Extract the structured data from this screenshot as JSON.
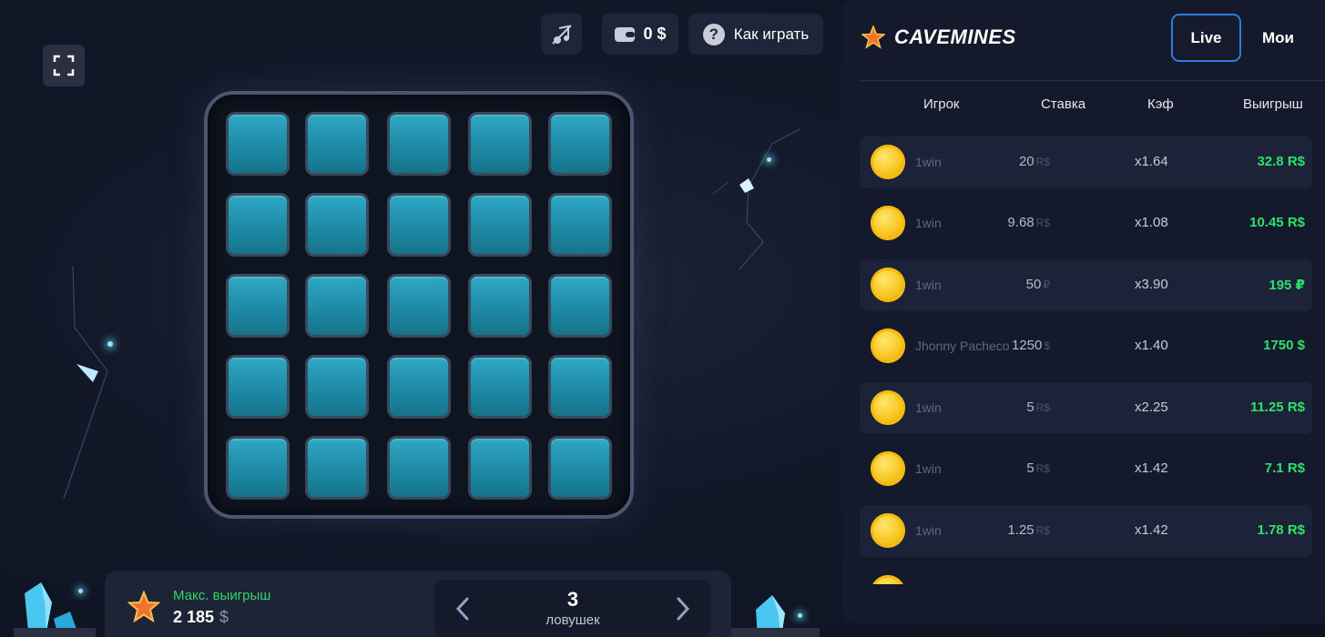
{
  "topbar": {
    "balance_value": "0",
    "balance_currency": "$",
    "help_label": "Как играть",
    "help_glyph": "?",
    "sound_icon": "sound-off-icon",
    "wallet_icon": "wallet-icon",
    "fullscreen_icon": "fullscreen-icon"
  },
  "board": {
    "rows": 5,
    "cols": 5
  },
  "bottom": {
    "maxwin_label": "Макс. выигрыш",
    "maxwin_value": "2 185",
    "maxwin_currency": "$",
    "traps_count": "3",
    "traps_label": "ловушек"
  },
  "sidebar": {
    "logo": "CAVEMINES",
    "tabs": [
      {
        "label": "Live"
      },
      {
        "label": "Мои"
      }
    ],
    "columns": {
      "player": "Игрок",
      "bet": "Ставка",
      "coef": "Кэф",
      "win": "Выигрыш"
    },
    "rows": [
      {
        "player": "1win",
        "bet": "20",
        "bet_currency": "R$",
        "coef": "x1.64",
        "win": "32.8 R$"
      },
      {
        "player": "1win",
        "bet": "9.68",
        "bet_currency": "R$",
        "coef": "x1.08",
        "win": "10.45 R$"
      },
      {
        "player": "1win",
        "bet": "50",
        "bet_currency": "₽",
        "coef": "x3.90",
        "win": "195 ₽"
      },
      {
        "player": "Jhonny Pacheco",
        "bet": "1250",
        "bet_currency": "$",
        "coef": "x1.40",
        "win": "1750 $"
      },
      {
        "player": "1win",
        "bet": "5",
        "bet_currency": "R$",
        "coef": "x2.25",
        "win": "11.25 R$"
      },
      {
        "player": "1win",
        "bet": "5",
        "bet_currency": "R$",
        "coef": "x1.42",
        "win": "7.1 R$"
      },
      {
        "player": "1win",
        "bet": "1.25",
        "bet_currency": "R$",
        "coef": "x1.42",
        "win": "1.78 R$"
      }
    ]
  },
  "colors": {
    "accent_blue": "#2d7bdc",
    "win_green": "#2fe06a",
    "tile": "#1e8aa6",
    "panel": "#141a2b"
  }
}
